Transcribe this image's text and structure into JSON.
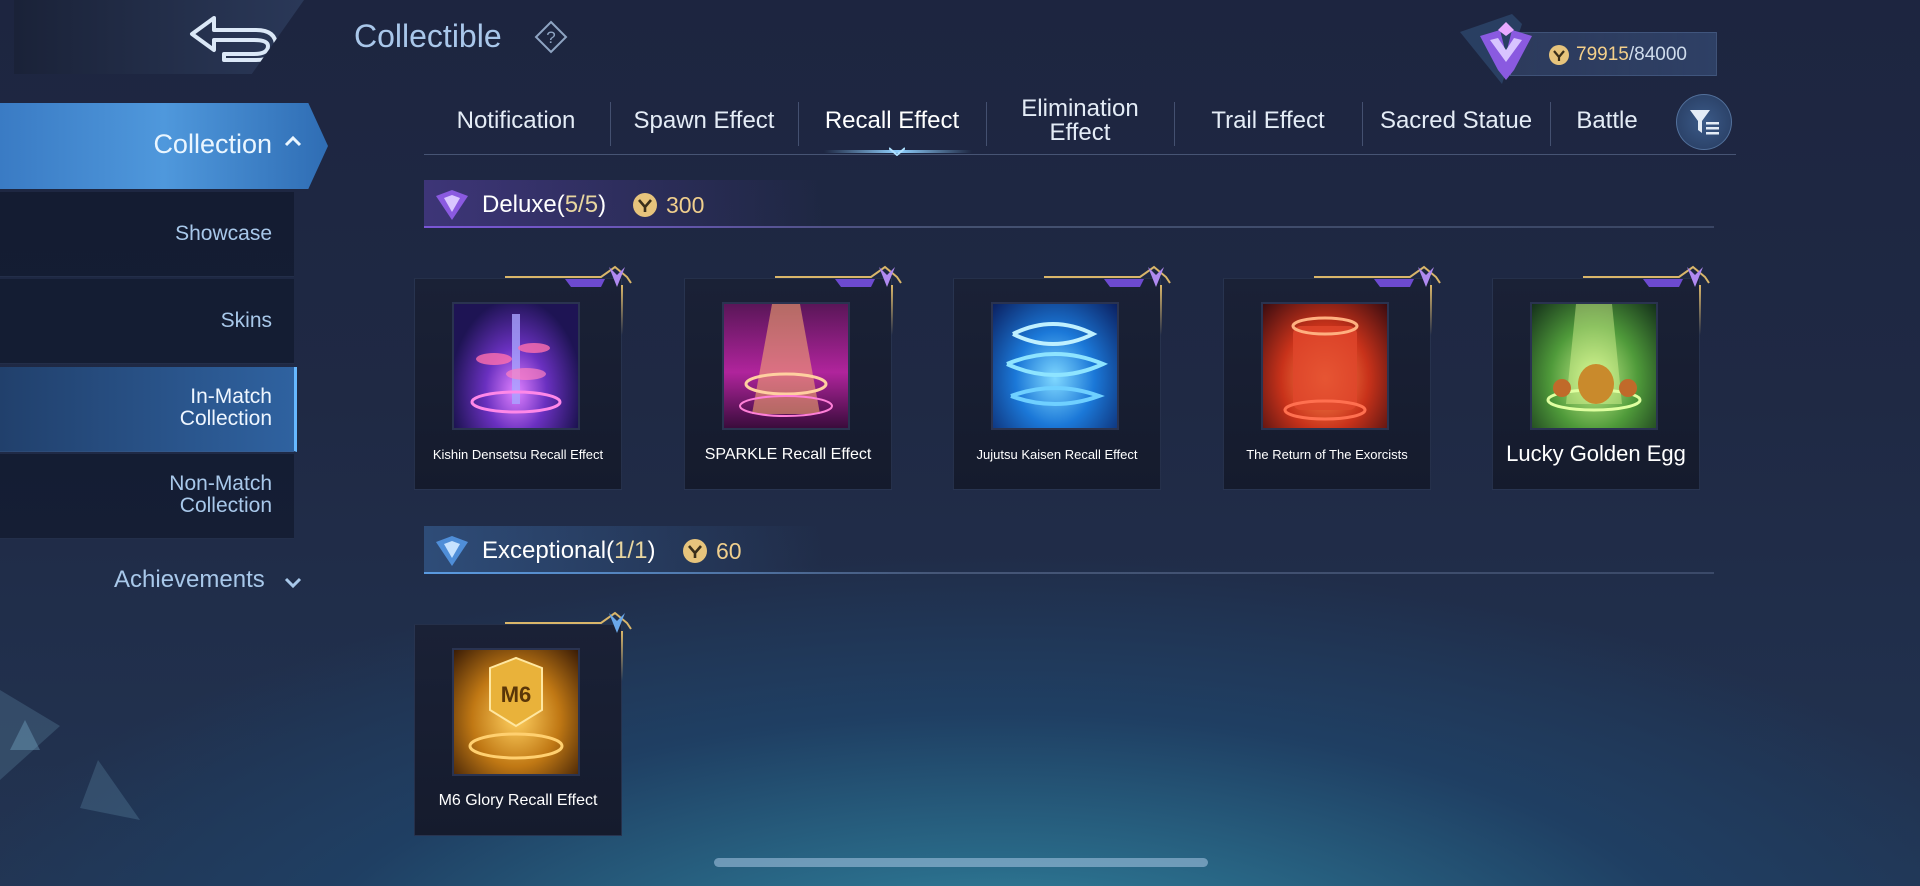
{
  "header": {
    "title": "Collectible",
    "back_icon": "back-arrow-icon",
    "help_icon": "question-icon",
    "points": {
      "current": "79915",
      "separator": "/",
      "max": "84000",
      "icon": "collector-coin-icon"
    }
  },
  "sidebar": {
    "collection_label": "Collection",
    "items": [
      {
        "label": "Showcase"
      },
      {
        "label": "Skins"
      },
      {
        "label_line1": "In-Match",
        "label_line2": "Collection"
      },
      {
        "label_line1": "Non-Match",
        "label_line2": "Collection"
      }
    ],
    "achievements_label": "Achievements"
  },
  "tabs": [
    {
      "label": "Notification"
    },
    {
      "label": "Spawn Effect"
    },
    {
      "label": "Recall Effect",
      "active": true
    },
    {
      "label_line1": "Elimination",
      "label_line2": "Effect"
    },
    {
      "label": "Trail Effect"
    },
    {
      "label": "Sacred Statue"
    },
    {
      "label": "Battle"
    }
  ],
  "sections": [
    {
      "title": "Deluxe(",
      "count": "5/5",
      "title_close": ")",
      "price": "300",
      "accent": "#8a5ae0",
      "items": [
        {
          "name": "Kishin Densetsu Recall Effect"
        },
        {
          "name": "SPARKLE Recall Effect"
        },
        {
          "name": "Jujutsu Kaisen Recall Effect"
        },
        {
          "name": "The Return of The Exorcists"
        },
        {
          "name": "Lucky Golden Egg"
        }
      ]
    },
    {
      "title": "Exceptional(",
      "count": "1/1",
      "title_close": ")",
      "price": "60",
      "accent": "#5a9ae0",
      "items": [
        {
          "name": "M6 Glory Recall Effect"
        }
      ]
    }
  ]
}
